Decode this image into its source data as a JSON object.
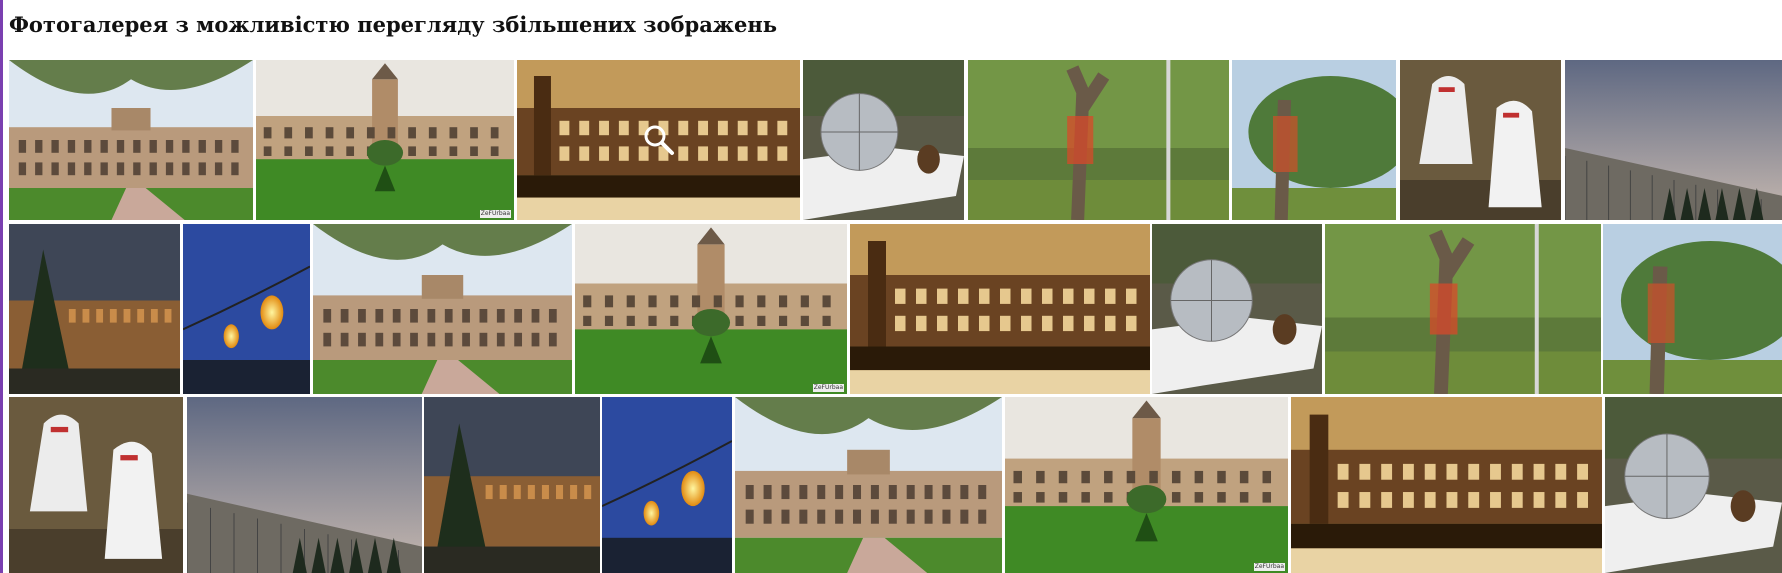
{
  "page": {
    "title": "Фотогалерея з можливістю перегляду збільшених зображень"
  },
  "gallery": {
    "hover_index": 2,
    "photo_credit": "ZeFUrbaa",
    "photos": [
      {
        "subject": "campus-facade-trees",
        "scene": "building-front"
      },
      {
        "subject": "campus-tower-lawn",
        "scene": "building-tower"
      },
      {
        "subject": "campus-sepia",
        "scene": "sepia"
      },
      {
        "subject": "disco-ball-sculpture",
        "scene": "ball"
      },
      {
        "subject": "decorated-tree",
        "scene": "tree"
      },
      {
        "subject": "decorated-tree-close",
        "scene": "tree2"
      },
      {
        "subject": "ghost-figures",
        "scene": "ghosts"
      },
      {
        "subject": "dormitory-dusk",
        "scene": "dusk"
      },
      {
        "subject": "stormy-buildings",
        "scene": "storm"
      },
      {
        "subject": "string-lights",
        "scene": "lights"
      },
      {
        "subject": "campus-facade-trees",
        "scene": "building-front"
      },
      {
        "subject": "campus-tower-lawn",
        "scene": "building-tower"
      },
      {
        "subject": "campus-sepia",
        "scene": "sepia"
      },
      {
        "subject": "disco-ball-sculpture",
        "scene": "ball"
      },
      {
        "subject": "decorated-tree",
        "scene": "tree"
      },
      {
        "subject": "decorated-tree-close",
        "scene": "tree2"
      },
      {
        "subject": "ghost-figures",
        "scene": "ghosts"
      },
      {
        "subject": "dormitory-dusk",
        "scene": "dusk"
      },
      {
        "subject": "stormy-buildings",
        "scene": "storm"
      },
      {
        "subject": "string-lights",
        "scene": "lights"
      },
      {
        "subject": "campus-facade-trees",
        "scene": "building-front"
      },
      {
        "subject": "campus-tower-lawn",
        "scene": "building-tower"
      },
      {
        "subject": "campus-sepia",
        "scene": "sepia"
      },
      {
        "subject": "disco-ball-sculpture",
        "scene": "ball"
      }
    ]
  }
}
